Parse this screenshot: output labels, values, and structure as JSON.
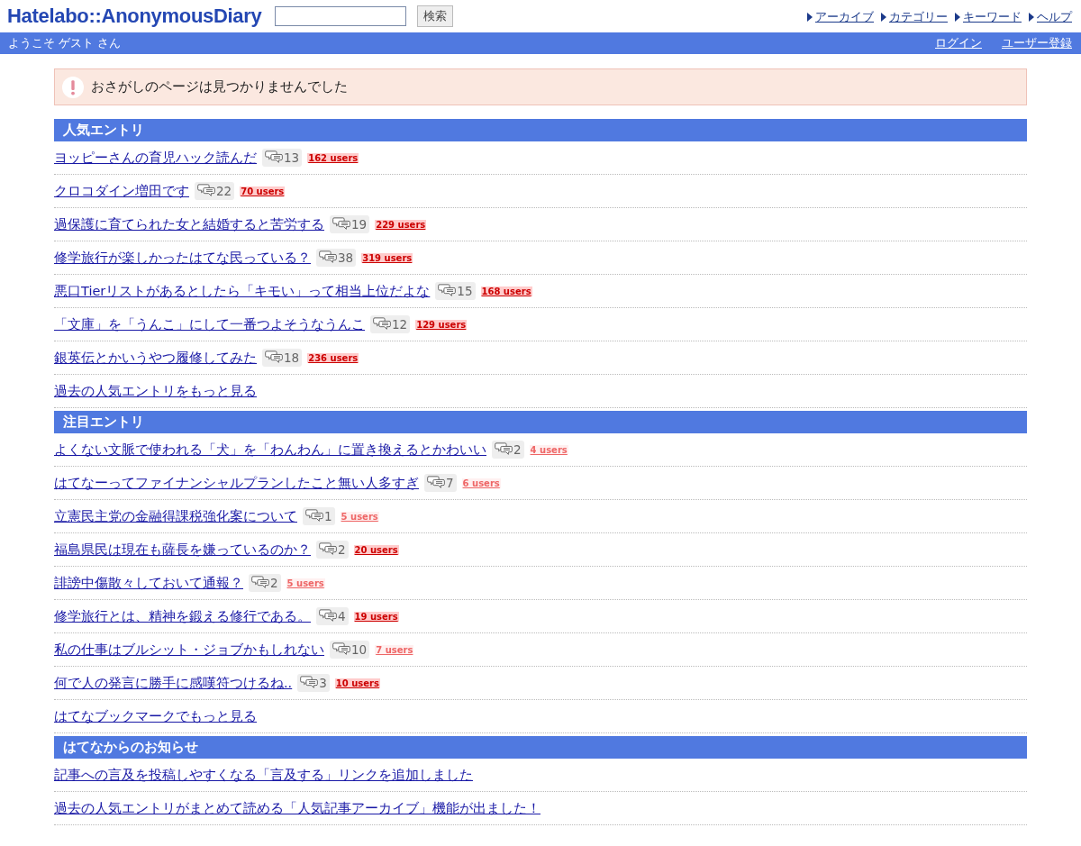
{
  "header": {
    "logo": "Hatelabo::AnonymousDiary",
    "search": {
      "button": "検索"
    },
    "nav": [
      "アーカイブ",
      "カテゴリー",
      "キーワード",
      "ヘルプ"
    ]
  },
  "user_bar": {
    "welcome": "ようこそ ゲスト さん",
    "links": [
      "ログイン",
      "ユーザー登録"
    ]
  },
  "alert": {
    "message": "おさがしのページは見つかりませんでした"
  },
  "sections": [
    {
      "title": "人気エントリ",
      "entries": [
        {
          "title": "ヨッピーさんの育児ハック読んだ",
          "comments": "13",
          "users": "162 users",
          "kind": "strong"
        },
        {
          "title": "クロコダイン増田です",
          "comments": "22",
          "users": "70 users",
          "kind": "strong"
        },
        {
          "title": "過保護に育てられた女と結婚すると苦労する",
          "comments": "19",
          "users": "229 users",
          "kind": "strong"
        },
        {
          "title": "修学旅行が楽しかったはてな民っている？",
          "comments": "38",
          "users": "319 users",
          "kind": "strong"
        },
        {
          "title": "悪口Tierリストがあるとしたら「キモい」って相当上位だよな",
          "comments": "15",
          "users": "168 users",
          "kind": "strong"
        },
        {
          "title": "「文庫」を「うんこ」にして一番つよそうなうんこ",
          "comments": "12",
          "users": "129 users",
          "kind": "strong"
        },
        {
          "title": "銀英伝とかいうやつ履修してみた",
          "comments": "18",
          "users": "236 users",
          "kind": "strong"
        }
      ],
      "more": "過去の人気エントリをもっと見る"
    },
    {
      "title": "注目エントリ",
      "entries": [
        {
          "title": "よくない文脈で使われる「犬」を「わんわん」に置き換えるとかわいい",
          "comments": "2",
          "users": "4 users",
          "kind": "light"
        },
        {
          "title": "はてなーってファイナンシャルプランしたこと無い人多すぎ",
          "comments": "7",
          "users": "6 users",
          "kind": "light"
        },
        {
          "title": "立憲民主党の金融得課税強化案について",
          "comments": "1",
          "users": "5 users",
          "kind": "light"
        },
        {
          "title": "福島県民は現在も薩長を嫌っているのか？",
          "comments": "2",
          "users": "20 users",
          "kind": "strong"
        },
        {
          "title": "誹謗中傷散々しておいて通報？",
          "comments": "2",
          "users": "5 users",
          "kind": "light"
        },
        {
          "title": "修学旅行とは、精神を鍛える修行である。",
          "comments": "4",
          "users": "19 users",
          "kind": "strong"
        },
        {
          "title": "私の仕事はブルシット・ジョブかもしれない",
          "comments": "10",
          "users": "7 users",
          "kind": "light"
        },
        {
          "title": "何で人の発言に勝手に感嘆符つけるね..",
          "comments": "3",
          "users": "10 users",
          "kind": "strong"
        }
      ],
      "more": "はてなブックマークでもっと見る"
    },
    {
      "title": "はてなからのお知らせ",
      "entries": [
        {
          "title": "記事への言及を投稿しやすくなる「言及する」リンクを追加しました"
        },
        {
          "title": "過去の人気エントリがまとめて読める「人気記事アーカイブ」機能が出ました！"
        }
      ]
    }
  ]
}
